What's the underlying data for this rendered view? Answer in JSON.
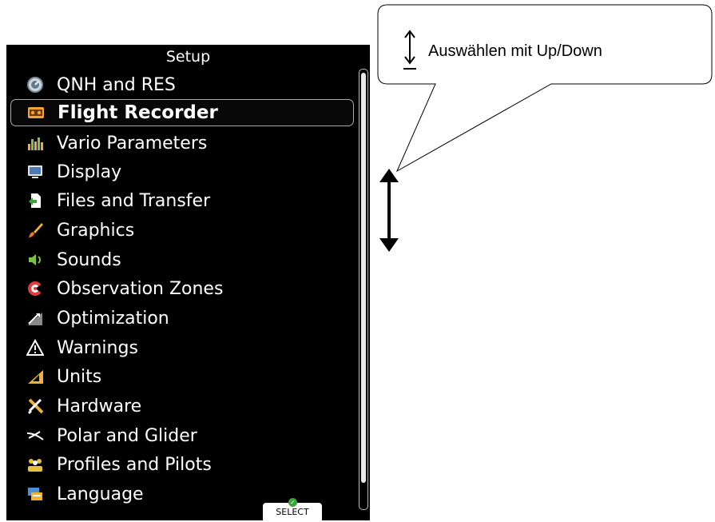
{
  "setup": {
    "title": "Setup",
    "items": [
      {
        "label": "QNH and RES",
        "icon": "altimeter-icon"
      },
      {
        "label": "Flight Recorder",
        "icon": "recorder-icon",
        "selected": true
      },
      {
        "label": "Vario Parameters",
        "icon": "vario-bars-icon"
      },
      {
        "label": "Display",
        "icon": "monitor-icon"
      },
      {
        "label": "Files and Transfer",
        "icon": "file-transfer-icon"
      },
      {
        "label": "Graphics",
        "icon": "brush-icon"
      },
      {
        "label": "Sounds",
        "icon": "speaker-icon"
      },
      {
        "label": "Observation Zones",
        "icon": "target-zone-icon"
      },
      {
        "label": "Optimization",
        "icon": "optimization-icon"
      },
      {
        "label": "Warnings",
        "icon": "warning-icon"
      },
      {
        "label": "Units",
        "icon": "set-square-icon"
      },
      {
        "label": "Hardware",
        "icon": "tools-icon"
      },
      {
        "label": "Polar and Glider",
        "icon": "glider-icon"
      },
      {
        "label": "Profiles and Pilots",
        "icon": "pilots-icon"
      },
      {
        "label": "Language",
        "icon": "language-icon"
      }
    ],
    "softkey": {
      "label": "SELECT",
      "icon": "check-icon"
    }
  },
  "callout": {
    "text": "Auswählen mit Up/Down",
    "icon": "up-down-arrow-icon"
  },
  "colors": {
    "screen_bg": "#000000",
    "text": "#ffffff",
    "selection_border": "#a8a8a8",
    "select_check": "#3aa536"
  }
}
